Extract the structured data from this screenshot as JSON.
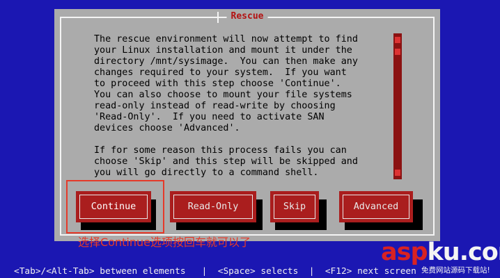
{
  "dialog": {
    "title": "Rescue",
    "message": "The rescue environment will now attempt to find\nyour Linux installation and mount it under the\ndirectory /mnt/sysimage.  You can then make any\nchanges required to your system.  If you want\nto proceed with this step choose 'Continue'.\nYou can also choose to mount your file systems\nread-only instead of read-write by choosing\n'Read-Only'.  If you need to activate SAN\ndevices choose 'Advanced'.\n\nIf for some reason this process fails you can\nchoose 'Skip' and this step will be skipped and\nyou will go directly to a command shell.",
    "buttons": {
      "continue": "Continue",
      "read_only": "Read-Only",
      "skip": "Skip",
      "advanced": "Advanced"
    }
  },
  "annotation": {
    "text": "选择Continue选项按回车就可以了"
  },
  "status_bar": {
    "text": "<Tab>/<Alt-Tab> between elements   |  <Space> selects  |  <F12> next screen"
  },
  "watermark": {
    "logo": "aspku.com",
    "tagline": "免费网站源码下载站!"
  },
  "colors": {
    "screen_bg": "#1b17b2",
    "dialog_bg": "#ababab",
    "button_bg": "#aa1e1e",
    "annotation": "#e53a2a"
  }
}
